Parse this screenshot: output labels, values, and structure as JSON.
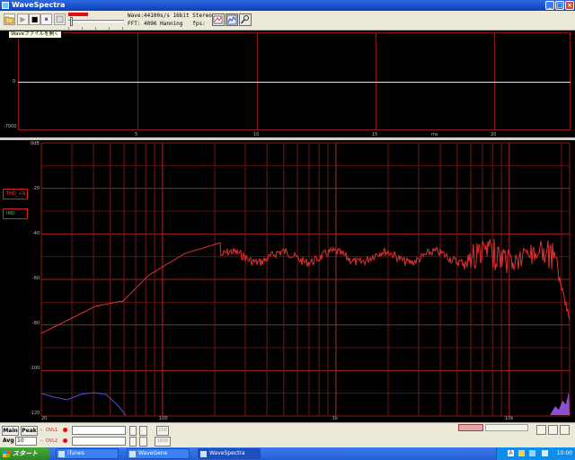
{
  "window": {
    "title": "WaveSpectra",
    "buttons": [
      "_",
      "□",
      "×"
    ]
  },
  "toolbar": {
    "info_line1": "Wave:44100s/s 16bit Stereo",
    "info_line2": "FFT: 4096 Hanning   fps:  73",
    "tooltip": "Waveファイルを開く",
    "play_glyph": "▶",
    "stop_glyph": "■",
    "pause_glyph": "⏸"
  },
  "waveform": {
    "y_labels": [
      "0",
      "-7000"
    ],
    "x_labels": [
      "5",
      "10",
      "15",
      "ms",
      "20"
    ]
  },
  "spectrum": {
    "y_labels": [
      "0dB",
      "-20",
      "-40",
      "-60",
      "-80",
      "-100",
      "-120"
    ],
    "x_labels": [
      "20",
      "100",
      "1k",
      "10k"
    ],
    "legend_thd": "THD_+N",
    "legend_imd": "IMD"
  },
  "controls": {
    "main_label": "Main",
    "peak_label": "Peak",
    "avg_label": "Avg",
    "avg_value": "10",
    "ovl1": "OVL1",
    "ovl2": "OVL2",
    "btn_100": "100",
    "btn_1000": "1000"
  },
  "taskbar": {
    "start_label": "スタート",
    "tasks": [
      "iTunes",
      "WaveGene",
      "WaveSpectra"
    ],
    "clock": "10:00",
    "ime": "A"
  },
  "colors": {
    "spectrum_red": "#e03030",
    "spectrum_blue": "#5050d0",
    "grid": "#8c1a1a",
    "wave_zero": "#ffe8a0"
  },
  "icons": [
    "open-file-icon",
    "record-icon",
    "play-icon",
    "stop-icon",
    "pause-icon",
    "settings-icon",
    "spectrum-view-icon",
    "tool-icon"
  ]
}
